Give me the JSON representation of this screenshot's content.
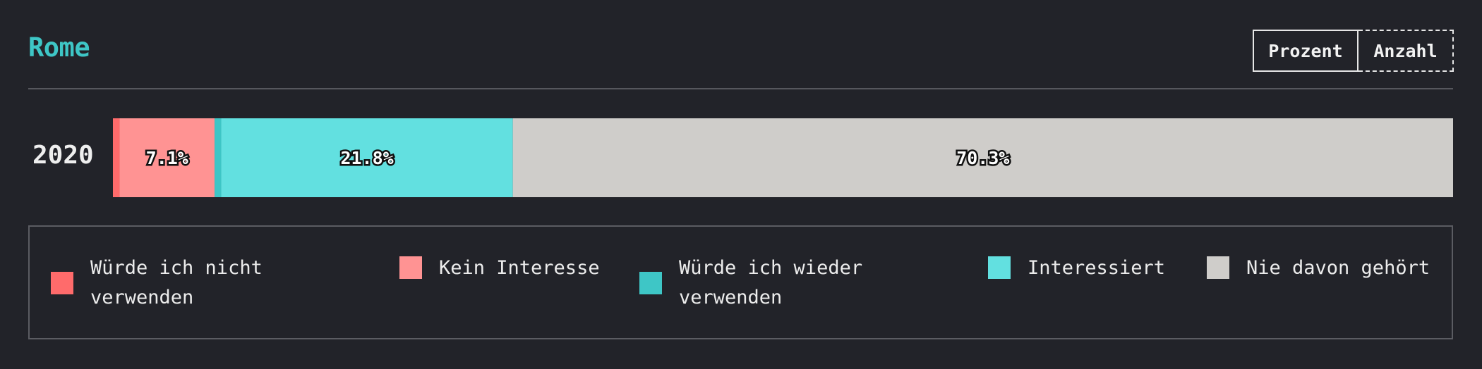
{
  "header": {
    "title": "Rome",
    "toggle": {
      "percent_label": "Prozent",
      "count_label": "Anzahl",
      "active": "percent"
    }
  },
  "chart_data": {
    "type": "bar",
    "orientation": "horizontal-stacked",
    "categories": [
      "2020"
    ],
    "series": [
      {
        "name": "Würde ich nicht verwenden",
        "values": [
          0.5
        ],
        "color": "#ff6b6b",
        "label": ""
      },
      {
        "name": "Kein Interesse",
        "values": [
          7.1
        ],
        "color": "#ff9393",
        "label": "7.1%"
      },
      {
        "name": "Würde ich wieder verwenden",
        "values": [
          0.5
        ],
        "color": "#3ec6c6",
        "label": ""
      },
      {
        "name": "Interessiert",
        "values": [
          21.8
        ],
        "color": "#62e0e0",
        "label": "21.8%"
      },
      {
        "name": "Nie davon gehört",
        "values": [
          70.3
        ],
        "color": "#cfcdca",
        "label": "70.3%"
      }
    ],
    "xlim": [
      0,
      100
    ],
    "legend_position": "bottom"
  },
  "legend": {
    "items": [
      {
        "label": "Würde ich nicht verwenden",
        "color": "#ff6b6b"
      },
      {
        "label": "Kein Interesse",
        "color": "#ff9393"
      },
      {
        "label": "Würde ich wieder verwenden",
        "color": "#3ec6c6"
      },
      {
        "label": "Interessiert",
        "color": "#62e0e0"
      },
      {
        "label": "Nie davon gehört",
        "color": "#cfcdca"
      }
    ]
  }
}
